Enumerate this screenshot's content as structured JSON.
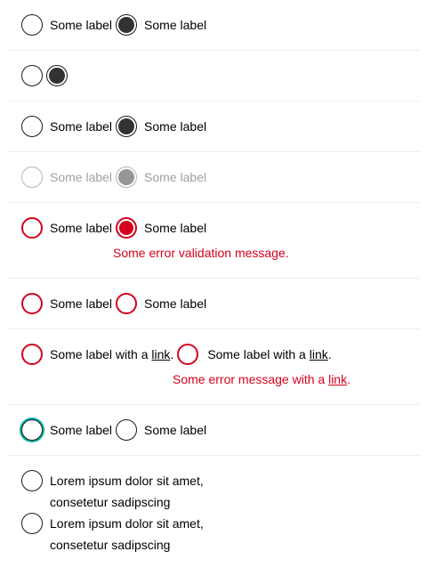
{
  "rows": {
    "basic": {
      "label_a": "Some label",
      "label_b": "Some label"
    },
    "no_label": {},
    "basic2": {
      "label_a": "Some label",
      "label_b": "Some label"
    },
    "disabled": {
      "label_a": "Some label",
      "label_b": "Some label"
    },
    "error_msg": {
      "label_a": "Some label",
      "label_b": "Some label",
      "message": "Some error validation message."
    },
    "error": {
      "label_a": "Some label",
      "label_b": "Some label"
    },
    "link": {
      "label_a_prefix": "Some label with a ",
      "label_a_link": "link",
      "label_a_suffix": ".",
      "label_b_prefix": "Some label with a ",
      "label_b_link": "link",
      "label_b_suffix": ".",
      "message_prefix": "Some error message with a ",
      "message_link": "link",
      "message_suffix": "."
    },
    "focus": {
      "label_a": "Some label",
      "label_b": "Some label"
    },
    "multiline": {
      "label_a": "Lorem ipsum dolor sit amet, consetetur sadipscing",
      "label_b": "Lorem ipsum dolor sit amet, consetetur sadipscing"
    }
  },
  "colors": {
    "error": "#d5001c",
    "checked": "#323232",
    "disabled": "#969696",
    "focus": "#00b0a0"
  }
}
